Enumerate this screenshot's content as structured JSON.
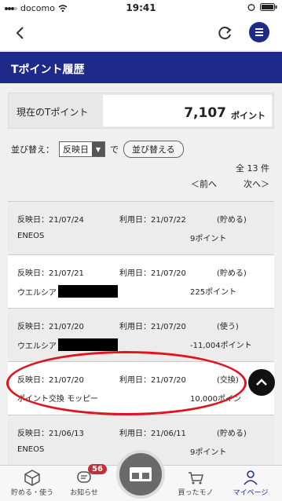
{
  "status": {
    "carrier": "docomo",
    "time": "19:41"
  },
  "page_title": "Tポイント履歴",
  "points": {
    "label": "現在のTポイント",
    "value": "7,107",
    "unit": "ポイント"
  },
  "sort": {
    "label": "並び替え：",
    "selected": "反映日",
    "connector": "で",
    "button": "並び替える"
  },
  "count": "全 13 件",
  "pager": {
    "prev": "＜前へ",
    "next": "次へ＞"
  },
  "rows": [
    {
      "reflect": "反映日：21/07/24",
      "used": "利用日：21/07/22",
      "kind": "(貯める)",
      "store": "ENEOS",
      "redacted": false,
      "points": "9ポイント"
    },
    {
      "reflect": "反映日：21/07/21",
      "used": "利用日：21/07/20",
      "kind": "(貯める)",
      "store": "ウエルシア",
      "redacted": true,
      "points": "225ポイント"
    },
    {
      "reflect": "反映日：21/07/20",
      "used": "利用日：21/07/20",
      "kind": "(使う)",
      "store": "ウエルシア",
      "redacted": true,
      "points": "-11,004ポイント"
    },
    {
      "reflect": "反映日：21/07/20",
      "used": "利用日：21/07/20",
      "kind": "(交換)",
      "store": "ポイント交換 モッピー",
      "redacted": false,
      "points": "10,000ポイン"
    },
    {
      "reflect": "反映日：21/06/13",
      "used": "利用日：21/06/11",
      "kind": "(貯める)",
      "store": "ENEOS",
      "redacted": false,
      "points": "9ポイント"
    }
  ],
  "tabs": [
    {
      "label": "貯める・使う",
      "icon": "cube-icon"
    },
    {
      "label": "お知らせ",
      "icon": "notice-icon",
      "badge": "56"
    },
    {
      "label": "",
      "icon": "card-icon"
    },
    {
      "label": "買ったモノ",
      "icon": "cart-icon"
    },
    {
      "label": "マイページ",
      "icon": "person-icon"
    }
  ],
  "colors": {
    "brand": "#1d2a8a",
    "highlight": "#e0141e",
    "badge": "#c0303a"
  }
}
